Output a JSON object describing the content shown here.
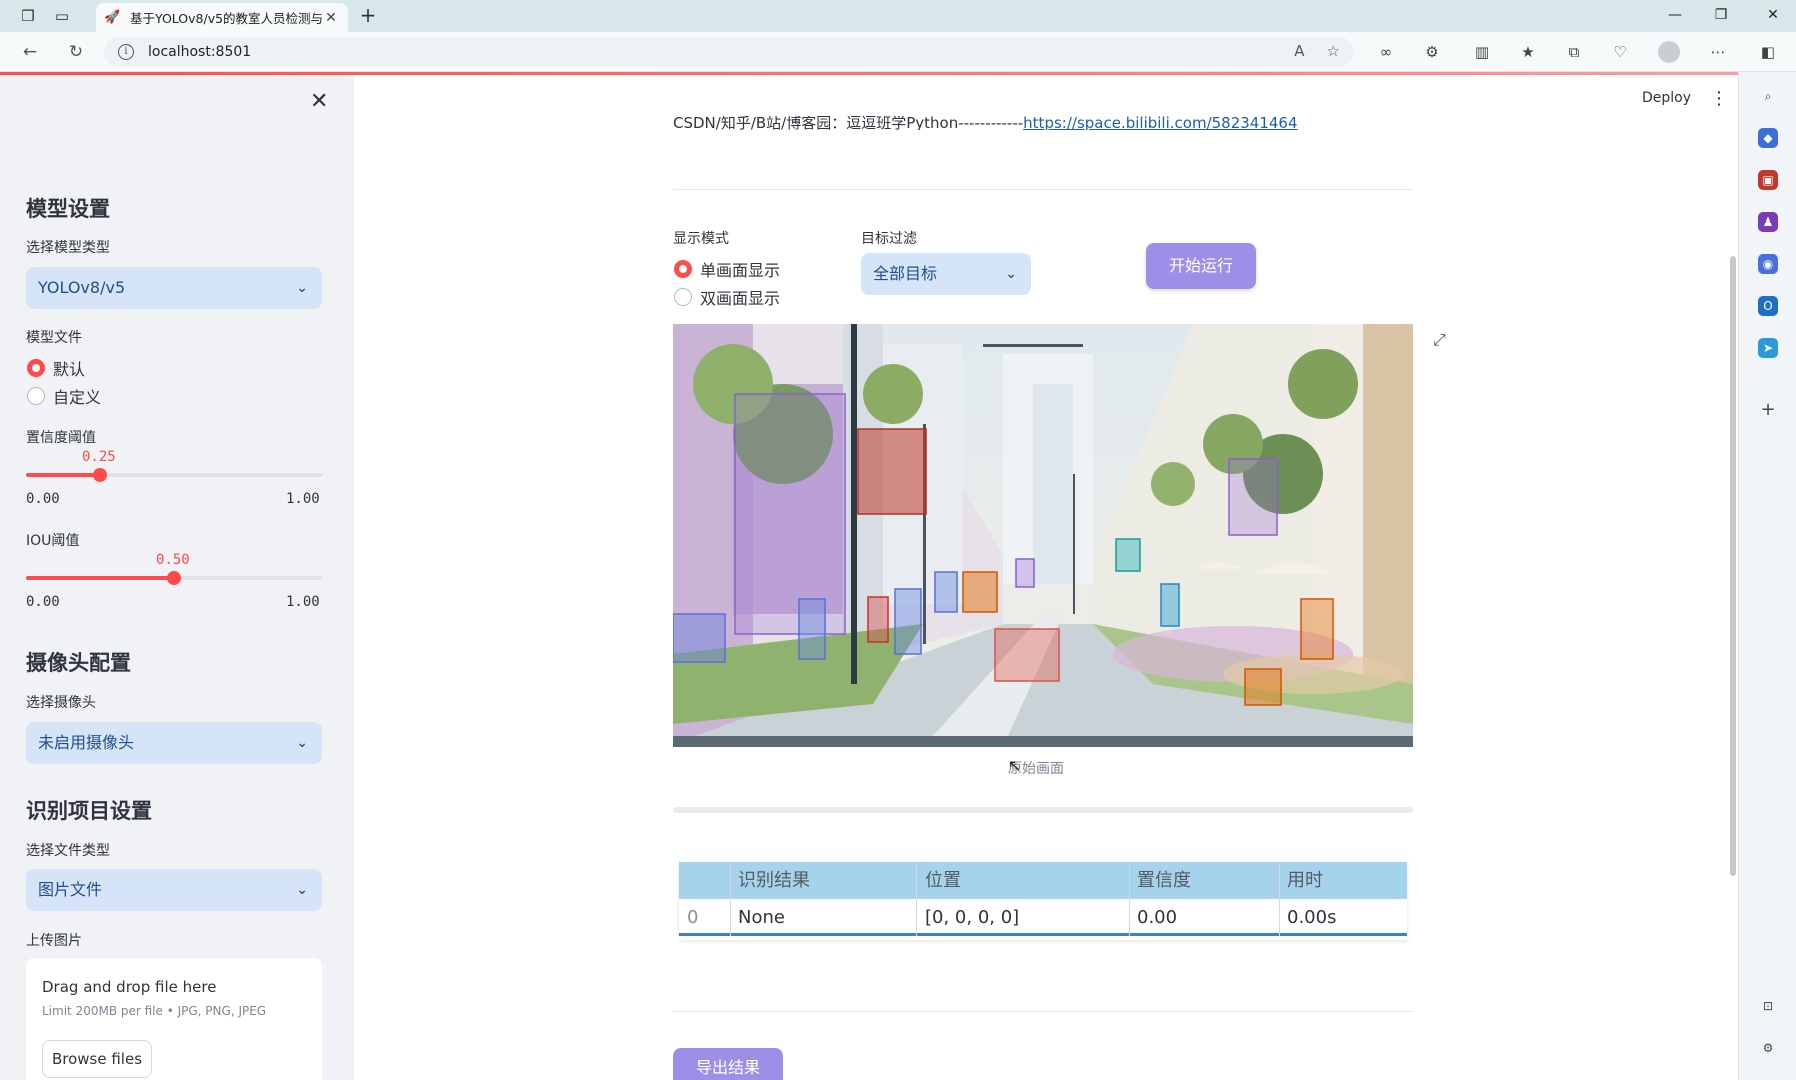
{
  "browser": {
    "tab_title": "基于YOLOv8/v5的教室人员检测与",
    "url": "localhost:8501",
    "read_aloud_label": "A",
    "colors": {
      "accent": "#ff4b4b",
      "tabbar": "#d8e8ea"
    }
  },
  "app": {
    "deploy_label": "Deploy",
    "link_prefix": "CSDN/知乎/B站/博客园：逗逗班学Python------------",
    "link_url": "https://space.bilibili.com/582341464"
  },
  "sidebar": {
    "model_section": "模型设置",
    "model_type_label": "选择模型类型",
    "model_type_value": "YOLOv8/v5",
    "model_file_label": "模型文件",
    "model_file_options": [
      "默认",
      "自定义"
    ],
    "model_file_selected": 0,
    "conf_label": "置信度阈值",
    "conf_value": "0.25",
    "conf_fraction": 0.25,
    "conf_min": "0.00",
    "conf_max": "1.00",
    "iou_label": "IOU阈值",
    "iou_value": "0.50",
    "iou_fraction": 0.5,
    "iou_min": "0.00",
    "iou_max": "1.00",
    "camera_section": "摄像头配置",
    "camera_label": "选择摄像头",
    "camera_value": "未启用摄像头",
    "detect_section": "识别项目设置",
    "file_type_label": "选择文件类型",
    "file_type_value": "图片文件",
    "upload_label": "上传图片",
    "upload_title": "Drag and drop file here",
    "upload_limit": "Limit 200MB per file • JPG, PNG, JPEG",
    "browse_label": "Browse files"
  },
  "main": {
    "display_mode_label": "显示模式",
    "display_mode_options": [
      "单画面显示",
      "双画面显示"
    ],
    "display_mode_selected": 0,
    "filter_label": "目标过滤",
    "filter_value": "全部目标",
    "run_button": "开始运行",
    "image_caption": "原始画面",
    "export_button": "导出结果"
  },
  "results_table": {
    "headers": [
      "",
      "识别结果",
      "位置",
      "置信度",
      "用时"
    ],
    "rows": [
      [
        "0",
        "None",
        "[0, 0, 0, 0]",
        "0.00",
        "0.00s"
      ]
    ]
  }
}
